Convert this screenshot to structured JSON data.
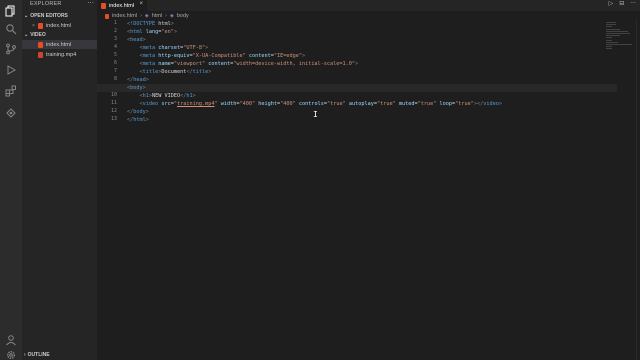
{
  "sidebar": {
    "header": "EXPLORER",
    "more": "···",
    "open_editors_label": "OPEN EDITORS",
    "open_editors": [
      {
        "name": "index.html",
        "close": "×"
      }
    ],
    "folder_label": "VIDEO",
    "files": [
      {
        "name": "index.html",
        "icon": "html-file-icon"
      },
      {
        "name": "training.mp4",
        "icon": "video-file-icon"
      }
    ],
    "outline_label": "OUTLINE"
  },
  "tabs": [
    {
      "label": "index.html",
      "close": "×"
    }
  ],
  "tab_actions": {
    "run": "▷",
    "split": "⊟",
    "more": "···"
  },
  "breadcrumb": [
    "index.html",
    "html",
    "body"
  ],
  "editor": {
    "line_numbers": [
      "1",
      "2",
      "3",
      "4",
      "5",
      "6",
      "7",
      "8",
      "9",
      "10",
      "11",
      "12",
      "13"
    ],
    "active_line": "9",
    "lines": [
      "<!DOCTYPE html>",
      "<html lang=\"en\">",
      "<head>",
      "    <meta charset=\"UTF-8\">",
      "    <meta http-equiv=\"X-UA-Compatible\" content=\"IE=edge\">",
      "    <meta name=\"viewport\" content=\"width=device-width, initial-scale=1.0\">",
      "    <title>Document</title>",
      "</head>",
      "<body>",
      "    <h1>NEW VIDEO</h1>",
      "    <video src=\"training.mp4\" width=\"400\" height=\"400\" controls=\"true\" autoplay=\"true\" muted=\"true\" loop=\"true\"></video>",
      "</body>",
      "</html>"
    ]
  },
  "colors": {
    "tag": "#569cd6",
    "attr": "#9cdcfe",
    "string": "#ce9178",
    "punct": "#808080",
    "html_icon": "#e44d26"
  }
}
